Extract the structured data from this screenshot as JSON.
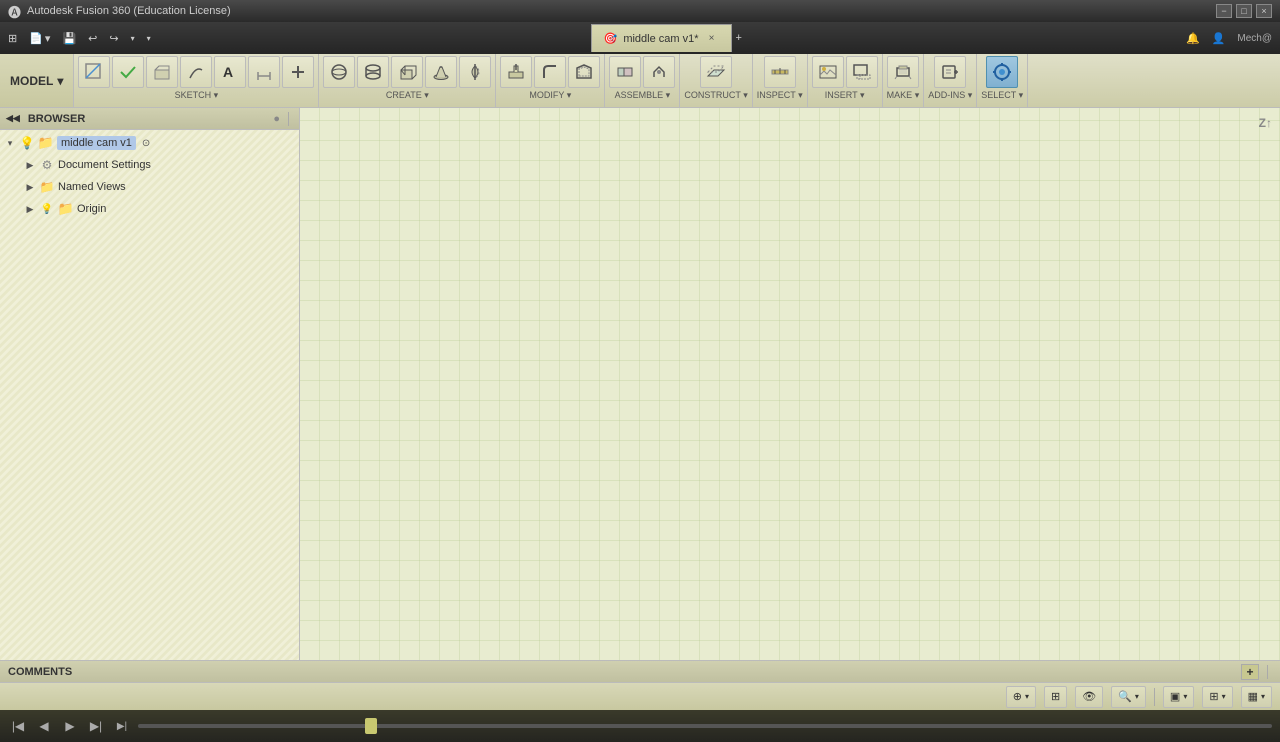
{
  "titleBar": {
    "appName": "Autodesk Fusion 360 (Education License)",
    "minimize": "−",
    "maximize": "□",
    "close": "×"
  },
  "tab": {
    "icon": "🎯",
    "label": "middle cam v1*",
    "closeLabel": "×"
  },
  "topToolbar": {
    "gridIcon": "⊞",
    "fileLabel": "File",
    "saveIcon": "💾",
    "undoIcon": "↩",
    "redoIcon": "↪"
  },
  "modelToolbar": {
    "modelLabel": "MODEL",
    "modelArrow": "▾",
    "groups": [
      {
        "label": "SKETCH",
        "arrow": "▾"
      },
      {
        "label": "CREATE",
        "arrow": "▾"
      },
      {
        "label": "MODIFY",
        "arrow": "▾"
      },
      {
        "label": "ASSEMBLE",
        "arrow": "▾"
      },
      {
        "label": "CONSTRUCT",
        "arrow": "▾"
      },
      {
        "label": "INSPECT",
        "arrow": "▾"
      },
      {
        "label": "INSERT",
        "arrow": "▾"
      },
      {
        "label": "MAKE",
        "arrow": "▾"
      },
      {
        "label": "ADD-INS",
        "arrow": "▾"
      },
      {
        "label": "SELECT",
        "arrow": "▾"
      }
    ]
  },
  "browser": {
    "title": "BROWSER",
    "collapseIcon": "◀◀",
    "pinIcon": "●",
    "items": [
      {
        "id": "root",
        "level": 0,
        "arrow": "▾",
        "icon": "light",
        "folderIcon": "📁",
        "label": "middle cam v1",
        "badge": "●",
        "selected": false
      },
      {
        "id": "doc-settings",
        "level": 1,
        "arrow": "▶",
        "icon": "gear",
        "label": "Document Settings",
        "selected": false
      },
      {
        "id": "named-views",
        "level": 1,
        "arrow": "▶",
        "icon": "folder",
        "label": "Named Views",
        "selected": false
      },
      {
        "id": "origin",
        "level": 1,
        "arrow": "▶",
        "icon": "light",
        "folderIcon": "📁",
        "label": "Origin",
        "selected": false
      }
    ]
  },
  "canvas": {
    "axisLabel": "Z↑"
  },
  "comments": {
    "label": "COMMENTS",
    "addIcon": "+"
  },
  "bottomBar": {
    "orbitIcon": "⊕",
    "panIcon": "✥",
    "lookIcon": "👁",
    "zoomIcon": "🔍",
    "displayIcon": "▣",
    "gridIcon": "⊞",
    "viewIcon": "▦"
  },
  "timeline": {
    "firstIcon": "|◀",
    "prevIcon": "◀",
    "playIcon": "▶",
    "nextIcon": "▶|",
    "lastIcon": "▶|"
  }
}
